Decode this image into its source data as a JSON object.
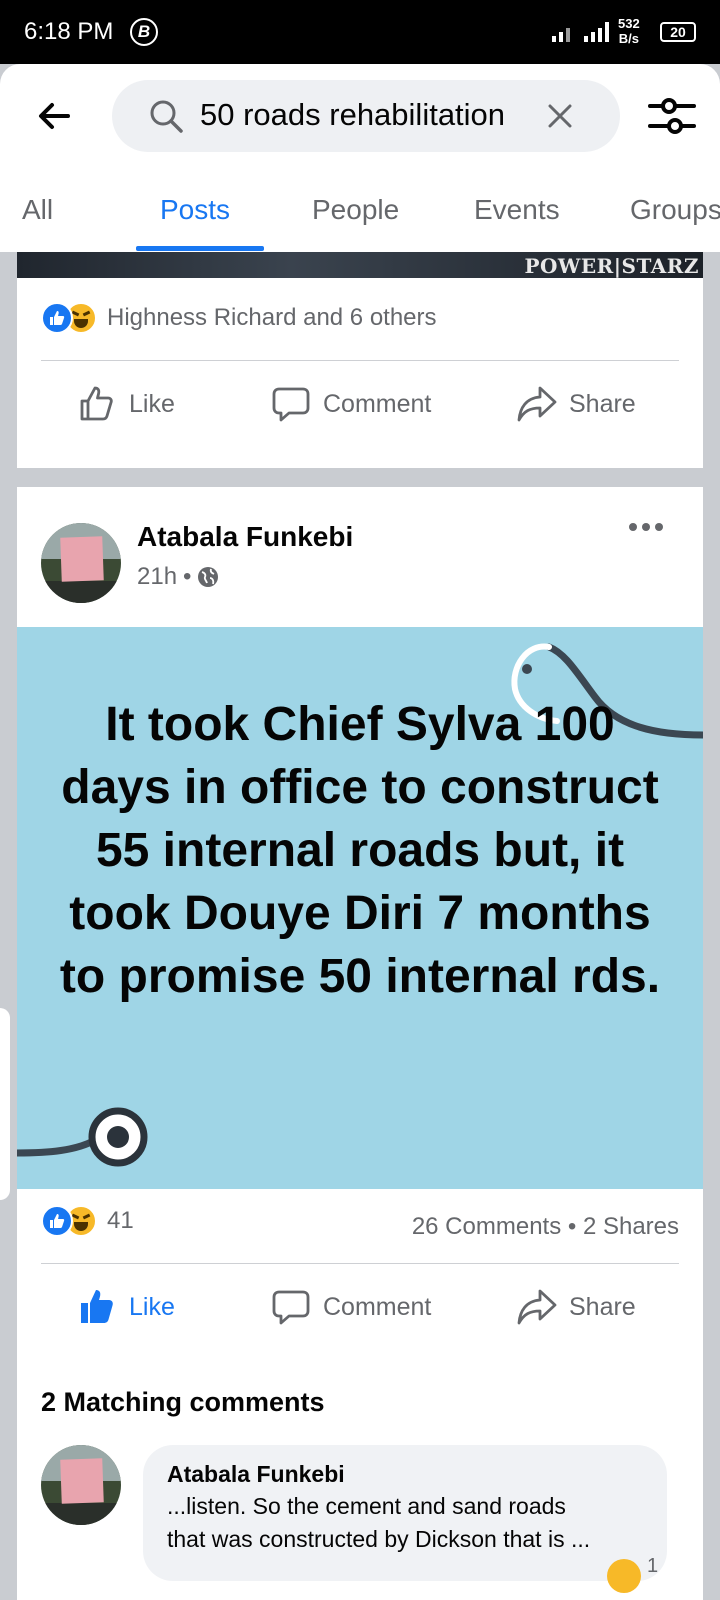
{
  "status_bar": {
    "time": "6:18 PM",
    "b_badge": "B",
    "net_speed_top": "532",
    "net_speed_bottom": "B/s",
    "battery": "20"
  },
  "search": {
    "query": "50 roads rehabilitation"
  },
  "tabs": [
    {
      "label": "All"
    },
    {
      "label": "Posts",
      "active": true
    },
    {
      "label": "People"
    },
    {
      "label": "Events"
    },
    {
      "label": "Groups"
    }
  ],
  "prev_post": {
    "watermark": "POWER|STARZ",
    "reactions_text": "Highness Richard and 6 others",
    "actions": {
      "like": "Like",
      "comment": "Comment",
      "share": "Share"
    }
  },
  "post": {
    "author": "Atabala Funkebi",
    "time": "21h",
    "separator": "•",
    "text": "It took Chief Sylva 100 days in office to construct 55 internal roads but, it took Douye Diri 7 months to promise 50 internal rds.",
    "reaction_count": "41",
    "comments_shares": "26 Comments • 2 Shares",
    "actions": {
      "like": "Like",
      "comment": "Comment",
      "share": "Share"
    },
    "matching_heading": "2 Matching comments",
    "comment": {
      "author": "Atabala Funkebi",
      "line1": "...listen. So the cement and sand roads",
      "line2": "that was constructed by Dickson that is ...",
      "reaction_count": "1"
    }
  },
  "colors": {
    "accent": "#1877f2",
    "banner": "#9fd5e6",
    "muted": "#65676b"
  }
}
